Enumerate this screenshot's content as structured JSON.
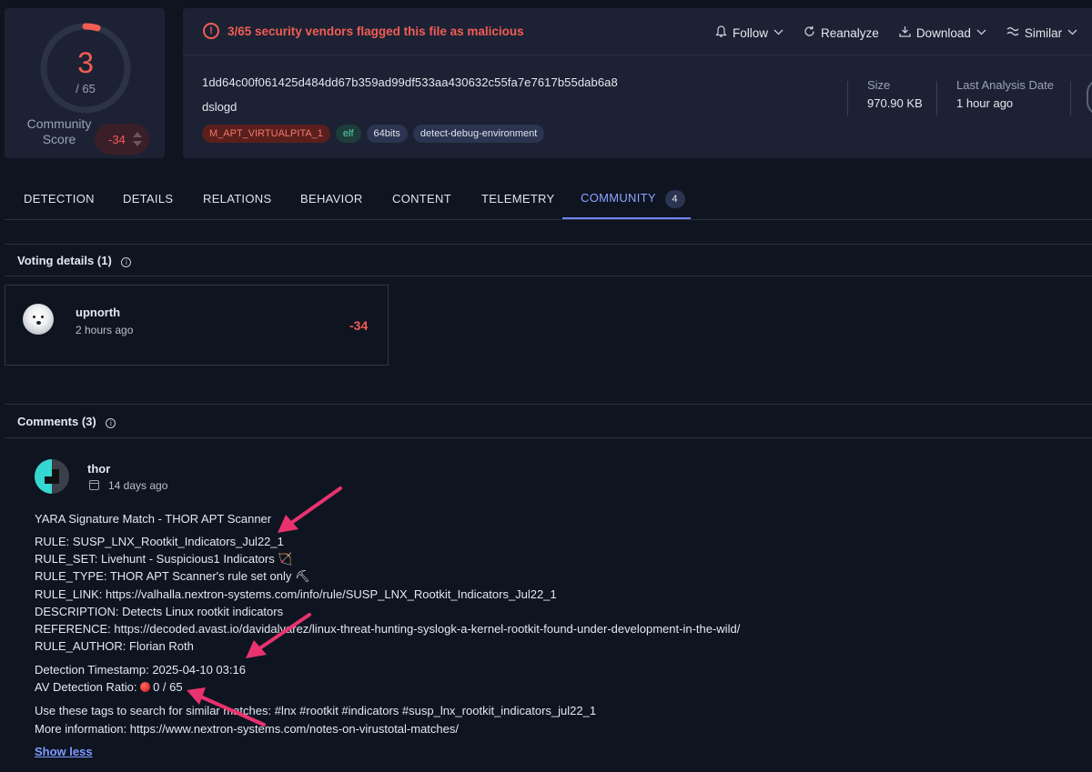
{
  "score": {
    "detections": "3",
    "total": "/ 65",
    "detection_fraction": 0.046,
    "community_label": "Community Score",
    "community_value": "-34"
  },
  "header": {
    "alert_icon": "alert-circle-icon",
    "alert_text": "3/65 security vendors flagged this file as malicious",
    "actions": [
      {
        "label": "Follow",
        "icon": "bell-icon"
      },
      {
        "label": "Reanalyze",
        "icon": "refresh-icon"
      },
      {
        "label": "Download",
        "icon": "download-icon"
      },
      {
        "label": "Similar",
        "icon": "similar-icon"
      }
    ],
    "hash": "1dd64c00f061425d484dd67b359ad99df533aa430632c55fa7e7617b55dab6a8",
    "filename": "dslogd",
    "tags": [
      "M_APT_VIRTUALPITA_1",
      "elf",
      "64bits",
      "detect-debug-environment"
    ],
    "size_label": "Size",
    "size_value": "970.90 KB",
    "date_label": "Last Analysis Date",
    "date_value": "1 hour ago"
  },
  "tabs": [
    {
      "label": "DETECTION"
    },
    {
      "label": "DETAILS"
    },
    {
      "label": "RELATIONS"
    },
    {
      "label": "BEHAVIOR"
    },
    {
      "label": "CONTENT"
    },
    {
      "label": "TELEMETRY"
    },
    {
      "label": "COMMUNITY",
      "count": "4",
      "active": true
    }
  ],
  "voting": {
    "title": "Voting details",
    "count": "(1)",
    "user": "upnorth",
    "time": "2 hours ago",
    "score": "-34"
  },
  "comments": {
    "title": "Comments",
    "count": "(3)",
    "user": "thor",
    "time": "14 days ago",
    "lines": [
      "YARA Signature Match - THOR APT Scanner",
      "RULE: SUSP_LNX_Rootkit_Indicators_Jul22_1",
      "RULE_SET: Livehunt - Suspicious1 Indicators 🏹",
      "RULE_TYPE: THOR APT Scanner's rule set only ⛏",
      "RULE_LINK: https://valhalla.nextron-systems.com/info/rule/SUSP_LNX_Rootkit_Indicators_Jul22_1",
      "DESCRIPTION: Detects Linux rootkit indicators",
      "REFERENCE: https://decoded.avast.io/davidalvarez/linux-threat-hunting-syslogk-a-kernel-rootkit-found-under-development-in-the-wild/",
      "RULE_AUTHOR: Florian Roth",
      "Detection Timestamp: 2025-04-10 03:16",
      "AV Detection Ratio: ",
      "Use these tags to search for similar matches: #lnx #rootkit #indicators #susp_lnx_rootkit_indicators_jul22_1",
      "More information: https://www.nextron-systems.com/notes-on-virustotal-matches/"
    ],
    "av_ratio": "0 / 65",
    "show_less": "Show less"
  },
  "colors": {
    "background": "#0f1421",
    "card": "#1c2233",
    "malicious": "#f25c54",
    "accent": "#6f86ff",
    "annotation_arrow": "#e8336f"
  }
}
